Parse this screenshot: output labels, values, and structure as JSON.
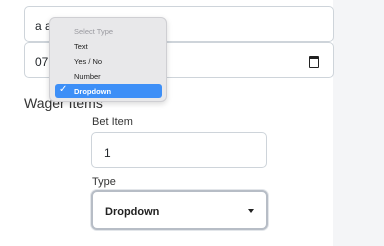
{
  "form": {
    "field_a_value": "a a",
    "field_date_value": "07"
  },
  "section": {
    "title": "Wager Items"
  },
  "bet_item": {
    "label": "Bet Item",
    "value": "1"
  },
  "type": {
    "label": "Type",
    "selected": "Dropdown"
  },
  "menu": {
    "header": "Select Type",
    "options": [
      "Text",
      "Yes / No",
      "Number",
      "Dropdown"
    ],
    "selected_index": 3
  },
  "colors": {
    "accent": "#3d8ff7",
    "border": "#ced4da"
  }
}
